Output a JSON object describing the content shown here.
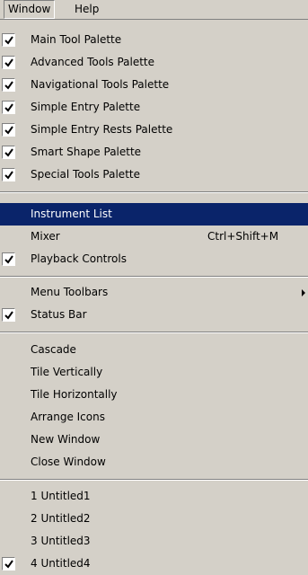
{
  "menubar": {
    "window_label": "Window",
    "help_label": "Help"
  },
  "menu": {
    "palettes": [
      {
        "label": "Main Tool Palette",
        "checked": true
      },
      {
        "label": "Advanced Tools Palette",
        "checked": true
      },
      {
        "label": "Navigational Tools Palette",
        "checked": true
      },
      {
        "label": "Simple Entry Palette",
        "checked": true
      },
      {
        "label": "Simple Entry Rests Palette",
        "checked": true
      },
      {
        "label": "Smart Shape Palette",
        "checked": true
      },
      {
        "label": "Special Tools Palette",
        "checked": true
      }
    ],
    "instrument_list": "Instrument List",
    "mixer": {
      "label": "Mixer",
      "shortcut": "Ctrl+Shift+M"
    },
    "playback_controls": {
      "label": "Playback Controls",
      "checked": true
    },
    "menu_toolbars": "Menu Toolbars",
    "status_bar": {
      "label": "Status Bar",
      "checked": true
    },
    "window_commands": [
      "Cascade",
      "Tile Vertically",
      "Tile Horizontally",
      "Arrange Icons",
      "New Window",
      "Close Window"
    ],
    "documents": [
      {
        "label": "1 Untitled1",
        "checked": false
      },
      {
        "label": "2 Untitled2",
        "checked": false
      },
      {
        "label": "3 Untitled3",
        "checked": false
      },
      {
        "label": "4 Untitled4",
        "checked": true
      }
    ]
  },
  "colors": {
    "menu_bg": "#d4d0c8",
    "highlight_bg": "#0a246a",
    "highlight_text": "#ffffff"
  },
  "icons": {
    "check": "checkmark-icon",
    "submenu": "submenu-arrow-icon"
  }
}
